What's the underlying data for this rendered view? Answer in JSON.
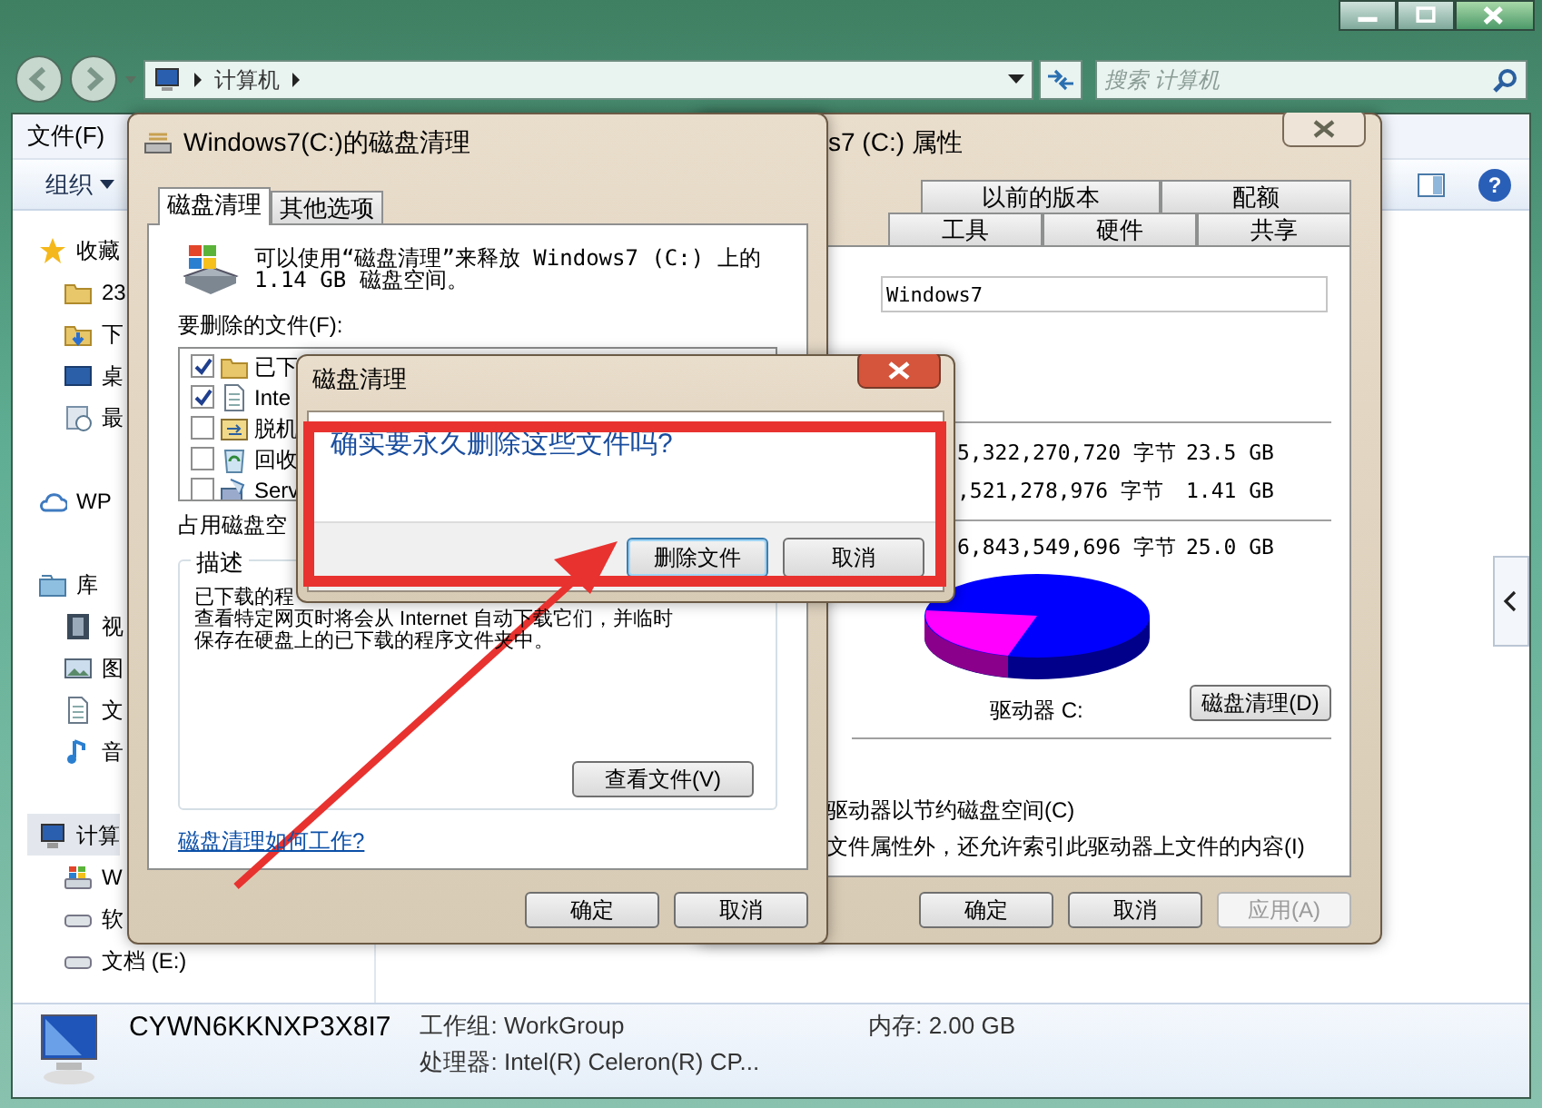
{
  "explorer": {
    "address": {
      "path": [
        "计算机"
      ]
    },
    "search": {
      "placeholder": "搜索 计算机"
    },
    "menu": [
      "文件(F)"
    ],
    "toolbar": {
      "organize": "组织",
      "help": "?"
    },
    "sidebar": [
      {
        "label": "收藏",
        "kind": "star",
        "selected": false,
        "children": [
          {
            "label": "23",
            "kind": "folder",
            "selected": false
          },
          {
            "label": "下",
            "kind": "folder-down",
            "selected": false
          },
          {
            "label": "桌",
            "kind": "desktop",
            "selected": false
          },
          {
            "label": "最",
            "kind": "recent",
            "selected": false
          }
        ]
      },
      {
        "label": "WP",
        "kind": "cloud",
        "selected": false
      },
      {
        "label": "库",
        "kind": "library",
        "selected": false,
        "children": [
          {
            "label": "视",
            "kind": "video",
            "selected": false
          },
          {
            "label": "图",
            "kind": "picture",
            "selected": false
          },
          {
            "label": "文",
            "kind": "document",
            "selected": false
          },
          {
            "label": "音",
            "kind": "music",
            "selected": false
          }
        ]
      },
      {
        "label": "计算",
        "kind": "computer",
        "selected": true,
        "children": [
          {
            "label": "W",
            "kind": "windows-drive",
            "selected": false
          },
          {
            "label": "软",
            "kind": "drive",
            "selected": false
          },
          {
            "label": "文档 (E:)",
            "kind": "drive",
            "selected": false
          }
        ]
      }
    ],
    "details": {
      "name": "CYWN6KKNXP3X8I7",
      "workgroup": "工作组: WorkGroup",
      "memory": "内存: 2.00 GB",
      "processor": "处理器: Intel(R) Celeron(R) CP..."
    }
  },
  "properties": {
    "title": "s7 (C:) 属性",
    "tab_rows": [
      [
        {
          "label": "以前的版本",
          "selected": false
        },
        {
          "label": "配额",
          "selected": false
        }
      ],
      [
        {
          "label": "工具",
          "selected": false
        },
        {
          "label": "硬件",
          "selected": false
        },
        {
          "label": "共享",
          "selected": false
        }
      ]
    ],
    "name_field": "Windows7",
    "space_rows": [
      {
        "bytes": "5,322,270,720 字节",
        "size": "23.5 GB"
      },
      {
        "bytes": ",521,278,976 字节",
        "size": "1.41 GB"
      },
      {
        "bytes": "6,843,549,696 字节",
        "size": "25.0 GB"
      }
    ],
    "drive_label": "驱动器 C:",
    "cleanup_button": "磁盘清理(D)",
    "options": [
      "驱动器以节约磁盘空间(C)",
      "文件属性外，还允许索引此驱动器上文件的内容(I)"
    ],
    "buttons": [
      {
        "label": "确定",
        "disabled": false
      },
      {
        "label": "取消",
        "disabled": false
      },
      {
        "label": "应用(A)",
        "disabled": true
      }
    ]
  },
  "cleanup": {
    "title": "Windows7(C:)的磁盘清理",
    "tabs": [
      {
        "label": "磁盘清理",
        "selected": true
      },
      {
        "label": "其他选项",
        "selected": false
      }
    ],
    "intro": "可以使用“磁盘清理”来释放 Windows7 (C:) 上的 1.14 GB 磁盘空间。",
    "files_label": "要删除的文件(F):",
    "files": [
      {
        "label": "已下",
        "kind": "folder",
        "checked": true
      },
      {
        "label": "Inte",
        "kind": "document",
        "checked": true
      },
      {
        "label": "脱机",
        "kind": "offline",
        "checked": false
      },
      {
        "label": "回收",
        "kind": "recycle",
        "checked": false
      },
      {
        "label": "Serv",
        "kind": "setup",
        "checked": false
      }
    ],
    "space_label": "占用磁盘空",
    "description": {
      "title": "描述",
      "lines": [
        "已下载的程",
        "查看特定网页时将会从 Internet 自动下载它们，并临时",
        "保存在硬盘上的已下载的程序文件夹中。"
      ]
    },
    "view_button": "查看文件(V)",
    "help_link": "磁盘清理如何工作?",
    "buttons": [
      "确定",
      "取消"
    ]
  },
  "confirm": {
    "title": "磁盘清理",
    "message": "确实要永久删除这些文件吗?",
    "buttons": [
      {
        "label": "删除文件",
        "default": true
      },
      {
        "label": "取消",
        "default": false
      }
    ]
  }
}
